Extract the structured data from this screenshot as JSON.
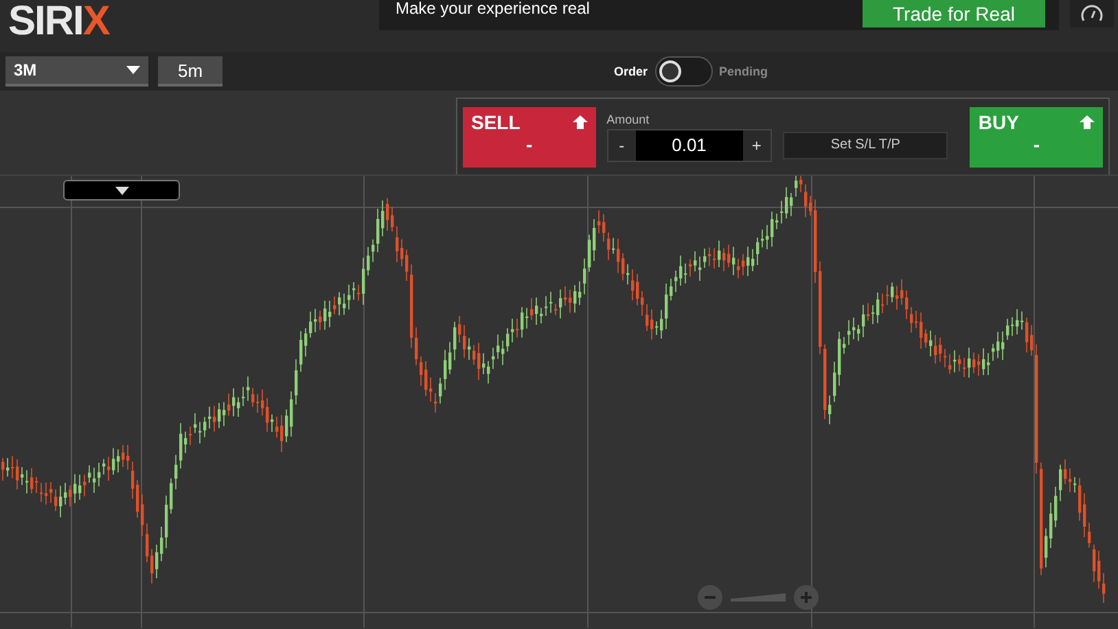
{
  "logo": {
    "text": "SIRI",
    "accent": "X"
  },
  "promo": {
    "message": "Make your experience real",
    "button": "Trade for Real"
  },
  "toolbar": {
    "period": "3M",
    "interval": "5m",
    "mode_left": "Order",
    "mode_right": "Pending",
    "pending_on": false
  },
  "trade_panel": {
    "sell": {
      "label": "SELL",
      "price": "-"
    },
    "amount_label": "Amount",
    "decrement": "-",
    "amount": "0.01",
    "increment": "+",
    "sltp": "Set S/L T/P",
    "buy": {
      "label": "BUY",
      "price": "-"
    }
  }
}
